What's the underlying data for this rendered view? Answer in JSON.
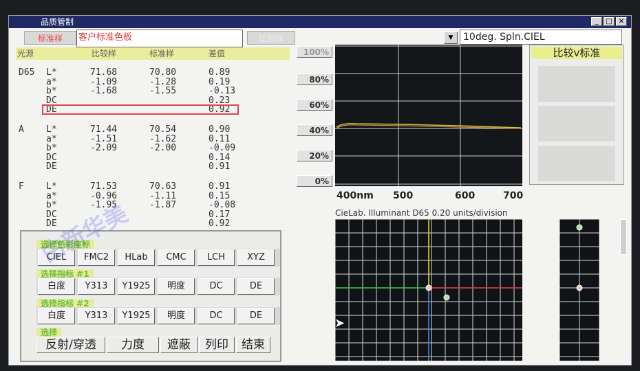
{
  "window": {
    "title": "品质管制",
    "controls": [
      "_",
      "□",
      "✕"
    ]
  },
  "tabs": {
    "standard": "标准样",
    "customer": "客户标准色板",
    "compare": "比较样"
  },
  "illuminant_select": {
    "value": "10deg. Spln.CIEL"
  },
  "table_header": {
    "light": "光源",
    "compare": "比较样",
    "standard": "标准样",
    "diff": "差值"
  },
  "illuminants": [
    {
      "name": "D65",
      "rows": [
        {
          "label": "L*",
          "cmp": "71.68",
          "std": "70.80",
          "diff": "0.89"
        },
        {
          "label": "a*",
          "cmp": "-1.09",
          "std": "-1.28",
          "diff": "0.19"
        },
        {
          "label": "b*",
          "cmp": "-1.68",
          "std": "-1.55",
          "diff": "-0.13"
        },
        {
          "label": "DC",
          "cmp": "",
          "std": "",
          "diff": "0.23"
        },
        {
          "label": "DE",
          "cmp": "",
          "std": "",
          "diff": "0.92"
        }
      ]
    },
    {
      "name": "A",
      "rows": [
        {
          "label": "L*",
          "cmp": "71.44",
          "std": "70.54",
          "diff": "0.90"
        },
        {
          "label": "a*",
          "cmp": "-1.51",
          "std": "-1.62",
          "diff": "0.11"
        },
        {
          "label": "b*",
          "cmp": "-2.09",
          "std": "-2.00",
          "diff": "-0.09"
        },
        {
          "label": "DC",
          "cmp": "",
          "std": "",
          "diff": "0.14"
        },
        {
          "label": "DE",
          "cmp": "",
          "std": "",
          "diff": "0.91"
        }
      ]
    },
    {
      "name": "F",
      "rows": [
        {
          "label": "L*",
          "cmp": "71.53",
          "std": "70.63",
          "diff": "0.91"
        },
        {
          "label": "a*",
          "cmp": "-0.96",
          "std": "-1.11",
          "diff": "0.15"
        },
        {
          "label": "b*",
          "cmp": "-1.95",
          "std": "-1.87",
          "diff": "-0.08"
        },
        {
          "label": "DC",
          "cmp": "",
          "std": "",
          "diff": "0.17"
        },
        {
          "label": "DE",
          "cmp": "",
          "std": "",
          "diff": "0.92"
        }
      ]
    }
  ],
  "percent_buttons": [
    "100%",
    "80%",
    "60%",
    "40%",
    "20%",
    "0%"
  ],
  "spectrum_xlabels": [
    "400nm",
    "500",
    "600",
    "700"
  ],
  "cielab_caption": "CieLab. Illuminant D65   0.20 units/division",
  "compare_panel": {
    "title": "比较v标准"
  },
  "selection": {
    "color_space_title": "选择色彩座标",
    "color_spaces": [
      "CIEL",
      "FMC2",
      "HLab",
      "CMC",
      "LCH",
      "XYZ"
    ],
    "index1_title": "选择指标 #1",
    "index1": [
      "白度",
      "Y313",
      "Y1925",
      "明度",
      "DC",
      "DE"
    ],
    "index2_title": "选择指标 #2",
    "index2": [
      "白度",
      "Y313",
      "Y1925",
      "明度",
      "DC",
      "DE"
    ],
    "choose_title": "选择",
    "actions": [
      "反射/穿透",
      "力度",
      "遮蔽",
      "列印",
      "结束"
    ]
  },
  "watermark": "由新华美",
  "colors": {
    "title_bar": "#1f2a64",
    "highlight_row": "#e8ee9a",
    "de_box": "#e04646"
  }
}
